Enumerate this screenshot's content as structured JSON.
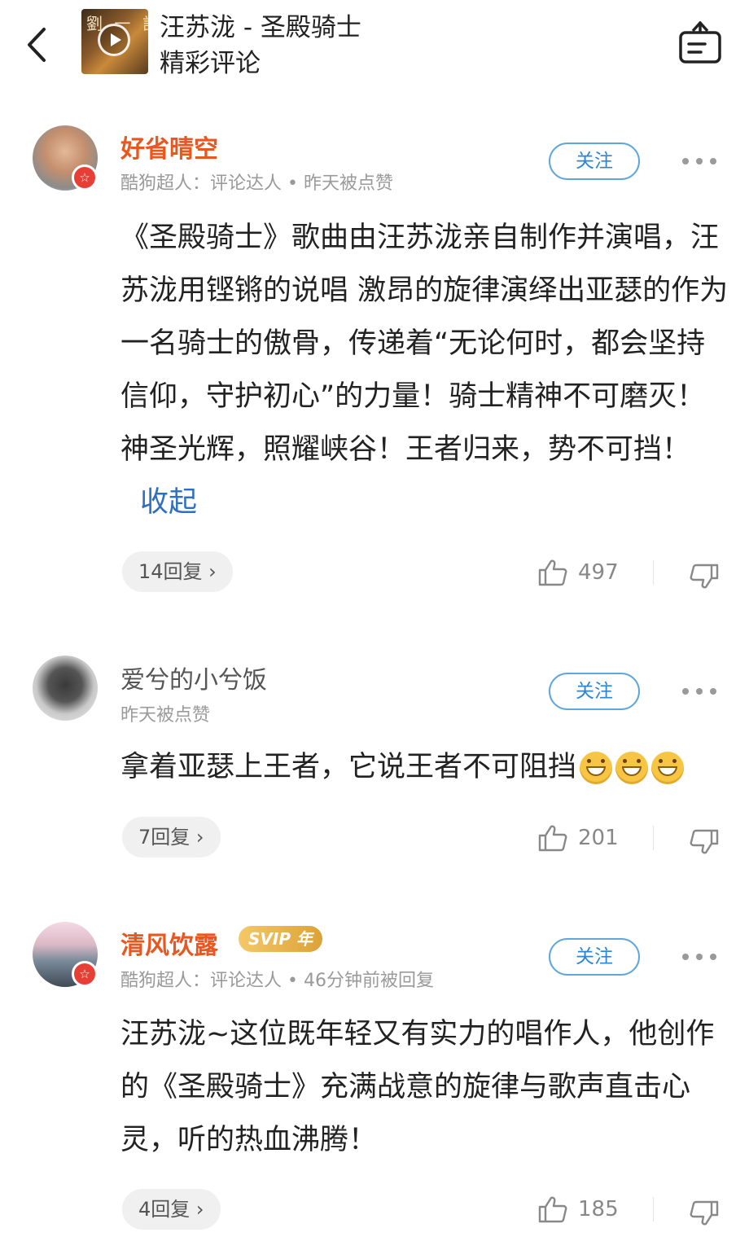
{
  "header": {
    "title": "汪苏泷 - 圣殿骑士",
    "subtitle": "精彩评论",
    "cover_text": "劉 一 計"
  },
  "comments": [
    {
      "username": "好省晴空",
      "vip_name": true,
      "meta": "酷狗超人：评论达人 • 昨天被点赞",
      "follow_label": "关注",
      "text": "《圣殿骑士》歌曲由汪苏泷亲自制作并演唱，汪苏泷用铿锵的说唱 激昂的旋律演绎出亚瑟的作为一名骑士的傲骨，传递着“无论何时，都会坚持信仰，守护初心”的力量！骑士精神不可磨灭！神圣光辉，照耀峡谷！王者归来，势不可挡！",
      "collapse_label": "收起",
      "reply_label": "14回复 ›",
      "likes": "497",
      "badge": "☆"
    },
    {
      "username": "爱兮的小兮饭",
      "vip_name": false,
      "meta": "昨天被点赞",
      "follow_label": "关注",
      "text": "拿着亚瑟上王者，它说王者不可阻挡",
      "emoji_icon": "grin-emoji-icon",
      "emoji_count": 3,
      "reply_label": "7回复 ›",
      "likes": "201"
    },
    {
      "username": "清风饮露",
      "vip_name": true,
      "svip_label": "SVIP 年",
      "meta": "酷狗超人：评论达人 • 46分钟前被回复",
      "follow_label": "关注",
      "text": "汪苏泷~这位既年轻又有实力的唱作人，他创作的《圣殿骑士》充满战意的旋律与歌声直击心灵，听的热血沸腾！",
      "reply_label": "4回复 ›",
      "likes": "185",
      "badge": "☆"
    }
  ],
  "colors": {
    "vip_name": "#e8571f",
    "link": "#2f6fc1",
    "follow_border": "#5fa6dc",
    "badge": "#e73f36"
  },
  "icons": {
    "back": "back-arrow-icon",
    "basket": "basket-icon",
    "like": "thumbs-up-icon",
    "dislike": "thumbs-down-icon",
    "more": "more-dots-icon"
  }
}
